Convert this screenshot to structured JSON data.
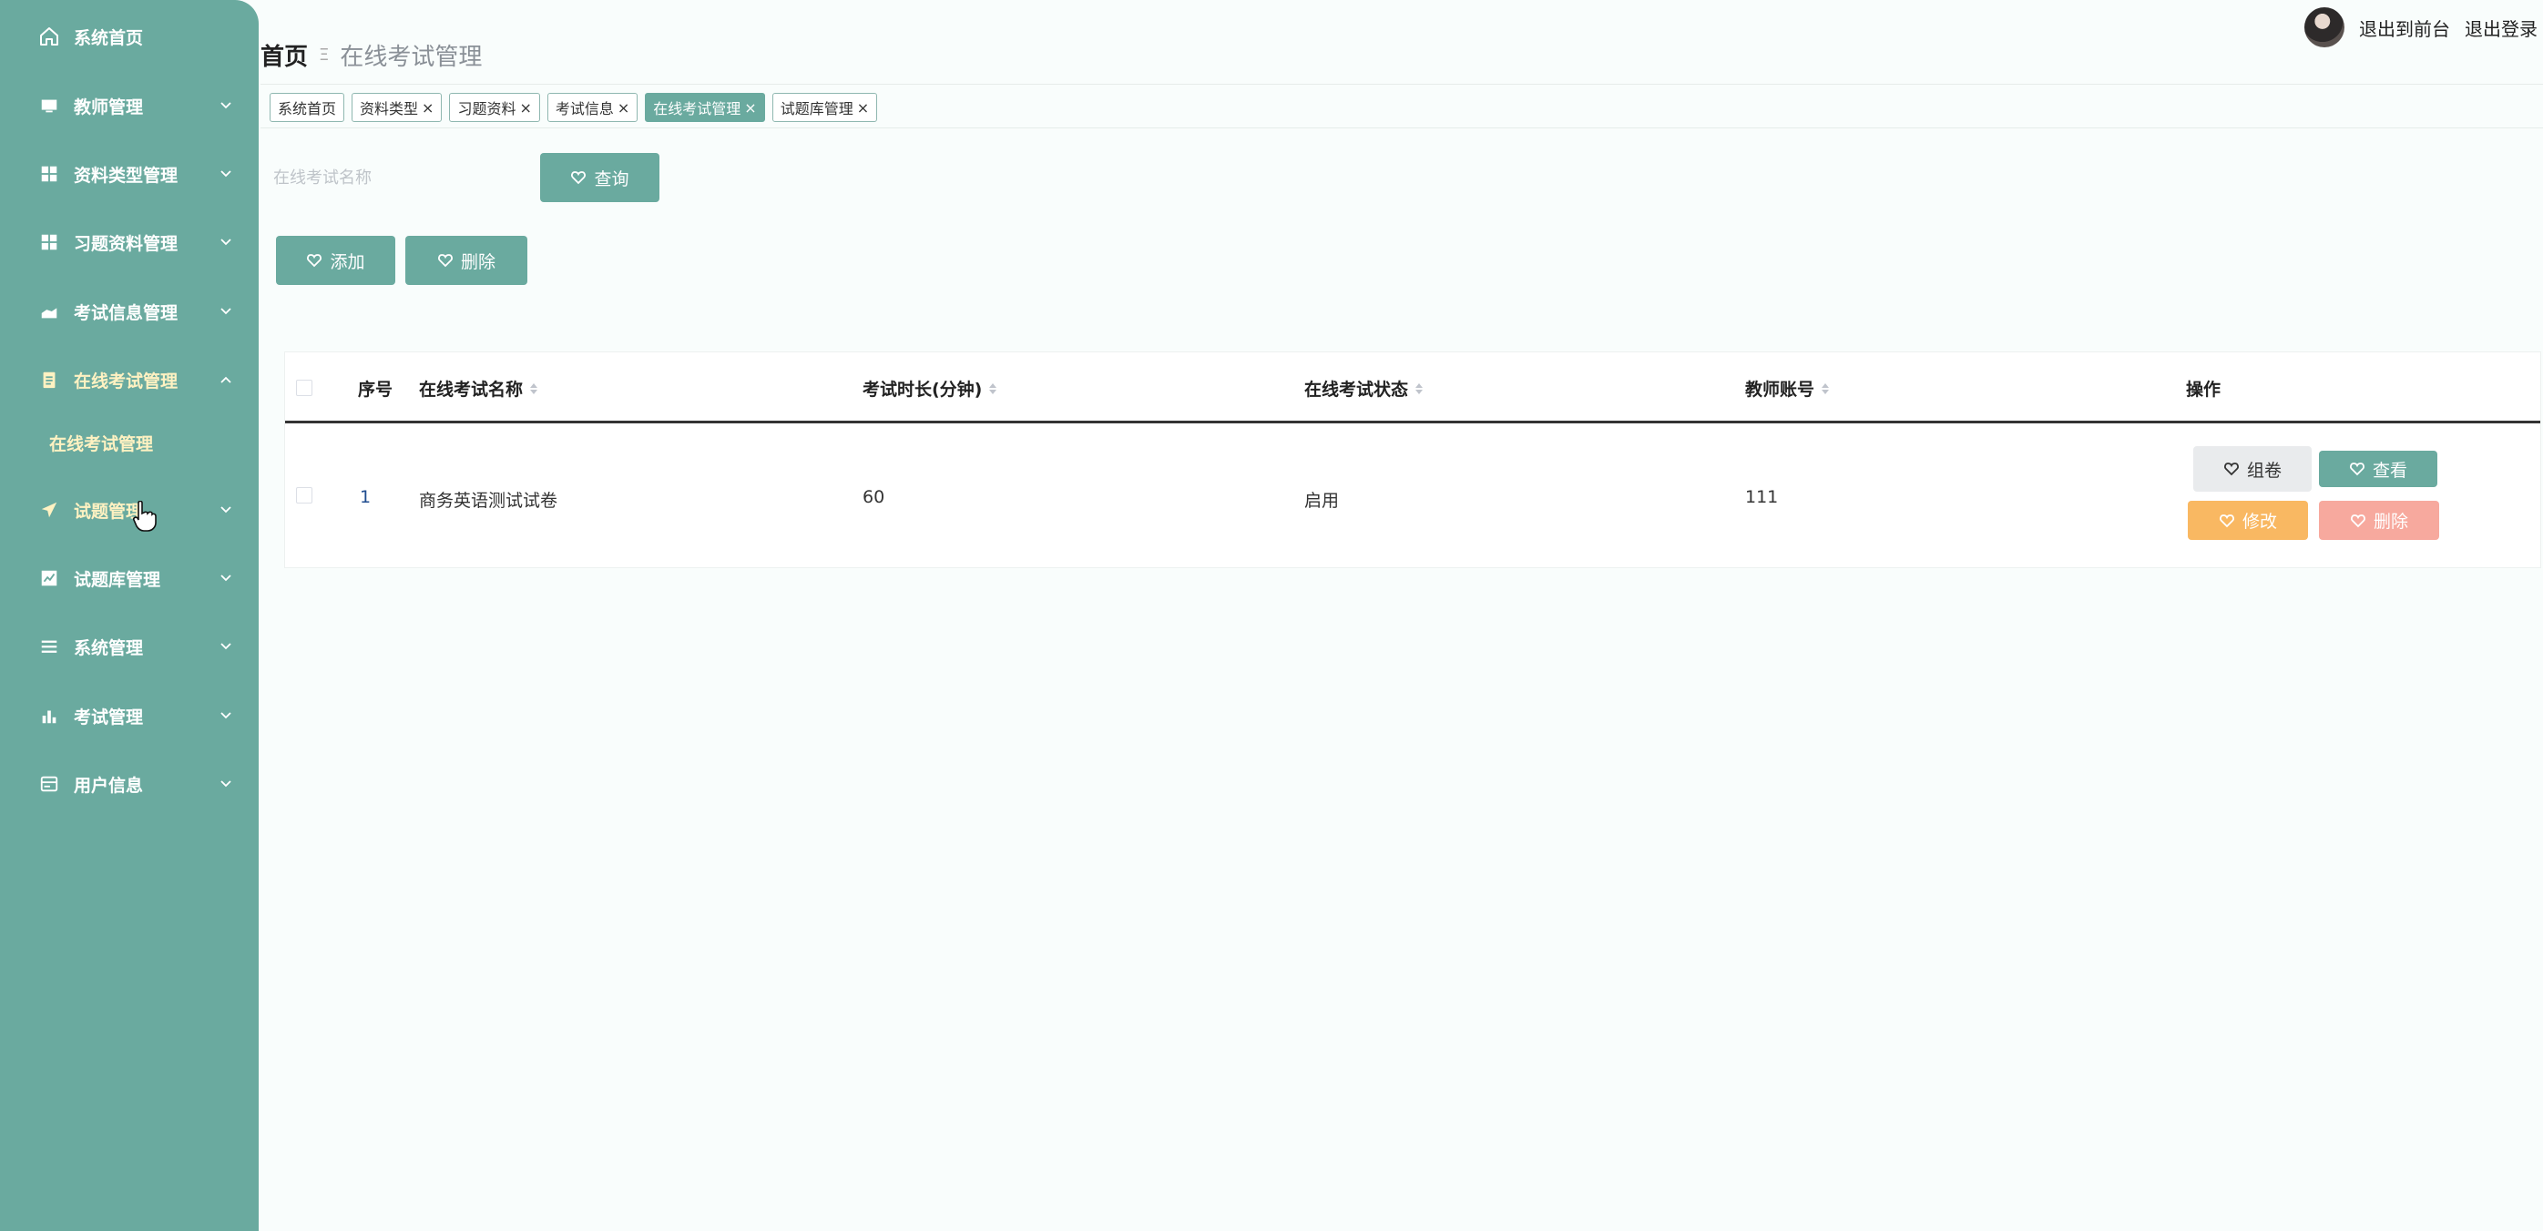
{
  "sidebar": {
    "items": [
      {
        "label": "系统首页",
        "icon": "home-icon"
      },
      {
        "label": "教师管理",
        "icon": "monitor-icon"
      },
      {
        "label": "资料类型管理",
        "icon": "grid-icon"
      },
      {
        "label": "习题资料管理",
        "icon": "grid-icon"
      },
      {
        "label": "考试信息管理",
        "icon": "hand-icon"
      },
      {
        "label": "在线考试管理",
        "icon": "clipboard-icon"
      },
      {
        "label": "试题管理",
        "icon": "send-icon"
      },
      {
        "label": "试题库管理",
        "icon": "chart-icon"
      },
      {
        "label": "系统管理",
        "icon": "list-icon"
      },
      {
        "label": "考试管理",
        "icon": "bar-icon"
      },
      {
        "label": "用户信息",
        "icon": "card-icon"
      }
    ],
    "submenu": {
      "label": "在线考试管理"
    },
    "colors": {
      "bg": "#6aaa9f",
      "active": "#fff2c2"
    }
  },
  "breadcrumb": {
    "home": "首页",
    "separator": "Ξ",
    "current": "在线考试管理"
  },
  "header": {
    "front": "退出到前台",
    "logout": "退出登录"
  },
  "tabs": [
    {
      "label": "系统首页",
      "closable": false
    },
    {
      "label": "资料类型",
      "closable": true
    },
    {
      "label": "习题资料",
      "closable": true
    },
    {
      "label": "考试信息",
      "closable": true
    },
    {
      "label": "在线考试管理",
      "closable": true,
      "active": true
    },
    {
      "label": "试题库管理",
      "closable": true
    }
  ],
  "search": {
    "placeholder": "在线考试名称",
    "button": "查询"
  },
  "actions": {
    "add": "添加",
    "delete": "删除"
  },
  "table": {
    "columns": [
      "序号",
      "在线考试名称",
      "考试时长(分钟)",
      "在线考试状态",
      "教师账号",
      "操作"
    ],
    "rows": [
      {
        "index": "1",
        "name": "商务英语测试试卷",
        "duration": "60",
        "status": "启用",
        "teacher": "111"
      }
    ],
    "row_actions": {
      "compose": "组卷",
      "view": "查看",
      "edit": "修改",
      "delete": "删除"
    }
  }
}
